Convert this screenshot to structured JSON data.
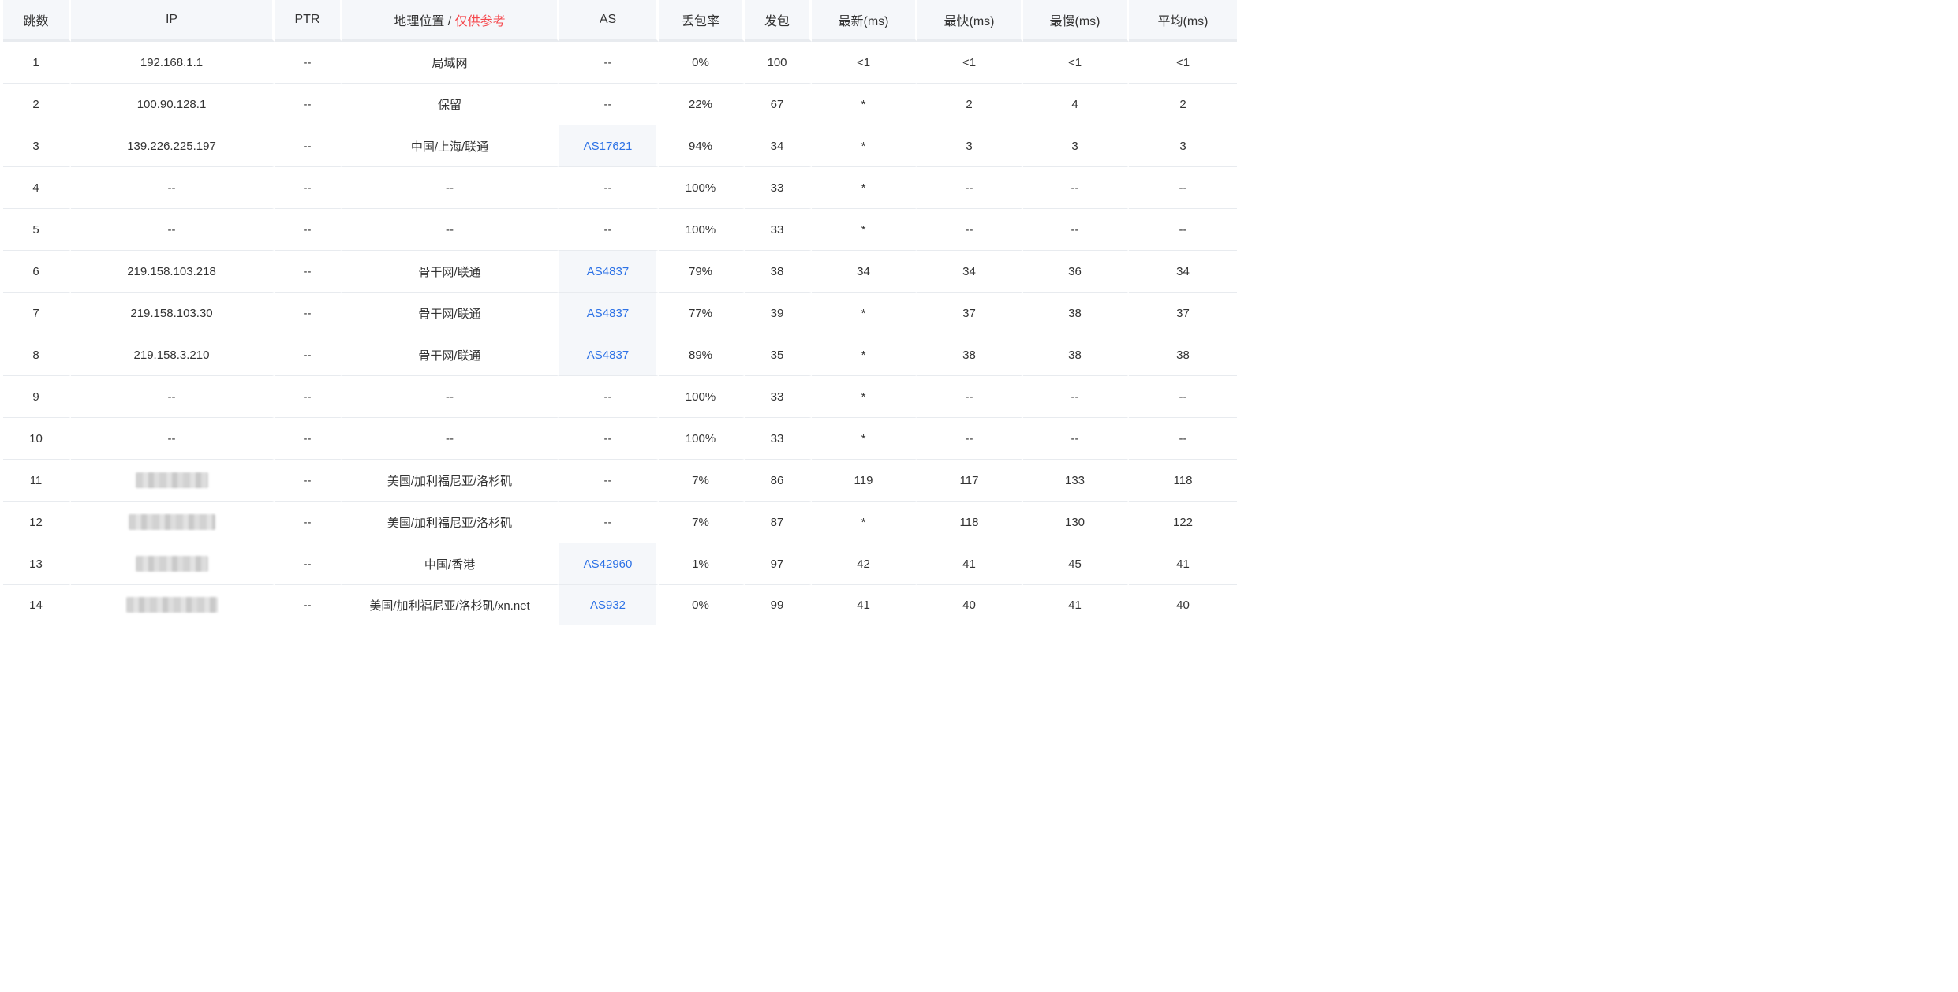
{
  "columns": {
    "hop": "跳数",
    "ip": "IP",
    "ptr": "PTR",
    "geo_prefix": "地理位置 / ",
    "geo_note": "仅供参考",
    "as": "AS",
    "loss": "丢包率",
    "sent": "发包",
    "last": "最新(ms)",
    "best": "最快(ms)",
    "worst": "最慢(ms)",
    "avg": "平均(ms)"
  },
  "colors": {
    "header_bg": "#f5f7fa",
    "as_link": "#2d72e6",
    "note_red": "#f5484d",
    "text": "#333333",
    "row_divider": "#e8ebef"
  },
  "rows": [
    {
      "hop": "1",
      "ip": "192.168.1.1",
      "ptr": "--",
      "geo": "局域网",
      "as": "--",
      "loss": "0%",
      "sent": "100",
      "last": "<1",
      "best": "<1",
      "worst": "<1",
      "avg": "<1"
    },
    {
      "hop": "2",
      "ip": "100.90.128.1",
      "ptr": "--",
      "geo": "保留",
      "as": "--",
      "loss": "22%",
      "sent": "67",
      "last": "*",
      "best": "2",
      "worst": "4",
      "avg": "2"
    },
    {
      "hop": "3",
      "ip": "139.226.225.197",
      "ptr": "--",
      "geo": "中国/上海/联通",
      "as": "AS17621",
      "loss": "94%",
      "sent": "34",
      "last": "*",
      "best": "3",
      "worst": "3",
      "avg": "3"
    },
    {
      "hop": "4",
      "ip": "--",
      "ptr": "--",
      "geo": "--",
      "as": "--",
      "loss": "100%",
      "sent": "33",
      "last": "*",
      "best": "--",
      "worst": "--",
      "avg": "--"
    },
    {
      "hop": "5",
      "ip": "--",
      "ptr": "--",
      "geo": "--",
      "as": "--",
      "loss": "100%",
      "sent": "33",
      "last": "*",
      "best": "--",
      "worst": "--",
      "avg": "--"
    },
    {
      "hop": "6",
      "ip": "219.158.103.218",
      "ptr": "--",
      "geo": "骨干网/联通",
      "as": "AS4837",
      "loss": "79%",
      "sent": "38",
      "last": "34",
      "best": "34",
      "worst": "36",
      "avg": "34"
    },
    {
      "hop": "7",
      "ip": "219.158.103.30",
      "ptr": "--",
      "geo": "骨干网/联通",
      "as": "AS4837",
      "loss": "77%",
      "sent": "39",
      "last": "*",
      "best": "37",
      "worst": "38",
      "avg": "37"
    },
    {
      "hop": "8",
      "ip": "219.158.3.210",
      "ptr": "--",
      "geo": "骨干网/联通",
      "as": "AS4837",
      "loss": "89%",
      "sent": "35",
      "last": "*",
      "best": "38",
      "worst": "38",
      "avg": "38"
    },
    {
      "hop": "9",
      "ip": "--",
      "ptr": "--",
      "geo": "--",
      "as": "--",
      "loss": "100%",
      "sent": "33",
      "last": "*",
      "best": "--",
      "worst": "--",
      "avg": "--"
    },
    {
      "hop": "10",
      "ip": "--",
      "ptr": "--",
      "geo": "--",
      "as": "--",
      "loss": "100%",
      "sent": "33",
      "last": "*",
      "best": "--",
      "worst": "--",
      "avg": "--"
    },
    {
      "hop": "11",
      "ip": "",
      "ip_redacted": true,
      "ptr": "--",
      "geo": "美国/加利福尼亚/洛杉矶",
      "as": "--",
      "loss": "7%",
      "sent": "86",
      "last": "119",
      "best": "117",
      "worst": "133",
      "avg": "118"
    },
    {
      "hop": "12",
      "ip": "",
      "ip_redacted": true,
      "ptr": "--",
      "geo": "美国/加利福尼亚/洛杉矶",
      "as": "--",
      "loss": "7%",
      "sent": "87",
      "last": "*",
      "best": "118",
      "worst": "130",
      "avg": "122"
    },
    {
      "hop": "13",
      "ip": "",
      "ip_redacted": true,
      "ptr": "--",
      "geo": "中国/香港",
      "as": "AS42960",
      "loss": "1%",
      "sent": "97",
      "last": "42",
      "best": "41",
      "worst": "45",
      "avg": "41"
    },
    {
      "hop": "14",
      "ip": "",
      "ip_redacted": true,
      "ptr": "--",
      "geo": "美国/加利福尼亚/洛杉矶/xn.net",
      "as": "AS932",
      "loss": "0%",
      "sent": "99",
      "last": "41",
      "best": "40",
      "worst": "41",
      "avg": "40"
    }
  ]
}
